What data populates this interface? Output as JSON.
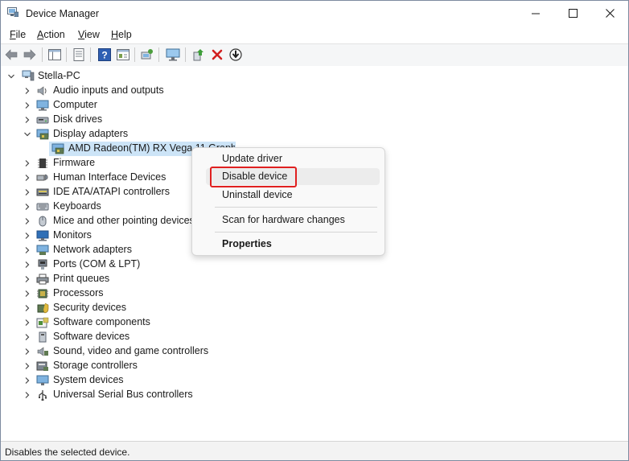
{
  "window": {
    "title": "Device Manager",
    "controls": {
      "minimize": "minimize-icon",
      "maximize": "maximize-icon",
      "close": "close-icon"
    }
  },
  "menu": {
    "file": "File",
    "action": "Action",
    "view": "View",
    "help": "Help"
  },
  "toolbar": [
    "back-arrow-icon",
    "forward-arrow-icon",
    "show-hide-console-tree-icon",
    "properties-sheet-icon",
    "help-icon",
    "view-list-icon",
    "scan-hardware-icon",
    "monitor-icon",
    "update-driver-icon",
    "uninstall-x-icon",
    "disable-device-icon"
  ],
  "tree": {
    "root": "Stella-PC",
    "categories": [
      {
        "label": "Audio inputs and outputs",
        "icon": "speaker-icon"
      },
      {
        "label": "Computer",
        "icon": "computer-icon"
      },
      {
        "label": "Disk drives",
        "icon": "disk-icon"
      },
      {
        "label": "Display adapters",
        "icon": "display-adapter-icon",
        "expanded": true,
        "child": "AMD Radeon(TM) RX Vega 11 Graphics"
      },
      {
        "label": "Firmware",
        "icon": "firmware-icon"
      },
      {
        "label": "Human Interface Devices",
        "icon": "hid-icon"
      },
      {
        "label": "IDE ATA/ATAPI controllers",
        "icon": "ide-icon"
      },
      {
        "label": "Keyboards",
        "icon": "keyboard-icon"
      },
      {
        "label": "Mice and other pointing devices",
        "icon": "mouse-icon"
      },
      {
        "label": "Monitors",
        "icon": "monitor-icon"
      },
      {
        "label": "Network adapters",
        "icon": "network-icon"
      },
      {
        "label": "Ports (COM & LPT)",
        "icon": "port-icon"
      },
      {
        "label": "Print queues",
        "icon": "printer-icon"
      },
      {
        "label": "Processors",
        "icon": "processor-icon"
      },
      {
        "label": "Security devices",
        "icon": "security-icon"
      },
      {
        "label": "Software components",
        "icon": "software-component-icon"
      },
      {
        "label": "Software devices",
        "icon": "software-device-icon"
      },
      {
        "label": "Sound, video and game controllers",
        "icon": "sound-icon"
      },
      {
        "label": "Storage controllers",
        "icon": "storage-icon"
      },
      {
        "label": "System devices",
        "icon": "system-icon"
      },
      {
        "label": "Universal Serial Bus controllers",
        "icon": "usb-icon"
      }
    ],
    "selected_child_visible": "AMD Radeon(TM) RX Vega 11 Graphi"
  },
  "context_menu": {
    "update_driver": "Update driver",
    "disable_device": "Disable device",
    "uninstall_device": "Uninstall device",
    "scan": "Scan for hardware changes",
    "properties": "Properties",
    "highlight_color": "#e02020"
  },
  "status": "Disables the selected device."
}
